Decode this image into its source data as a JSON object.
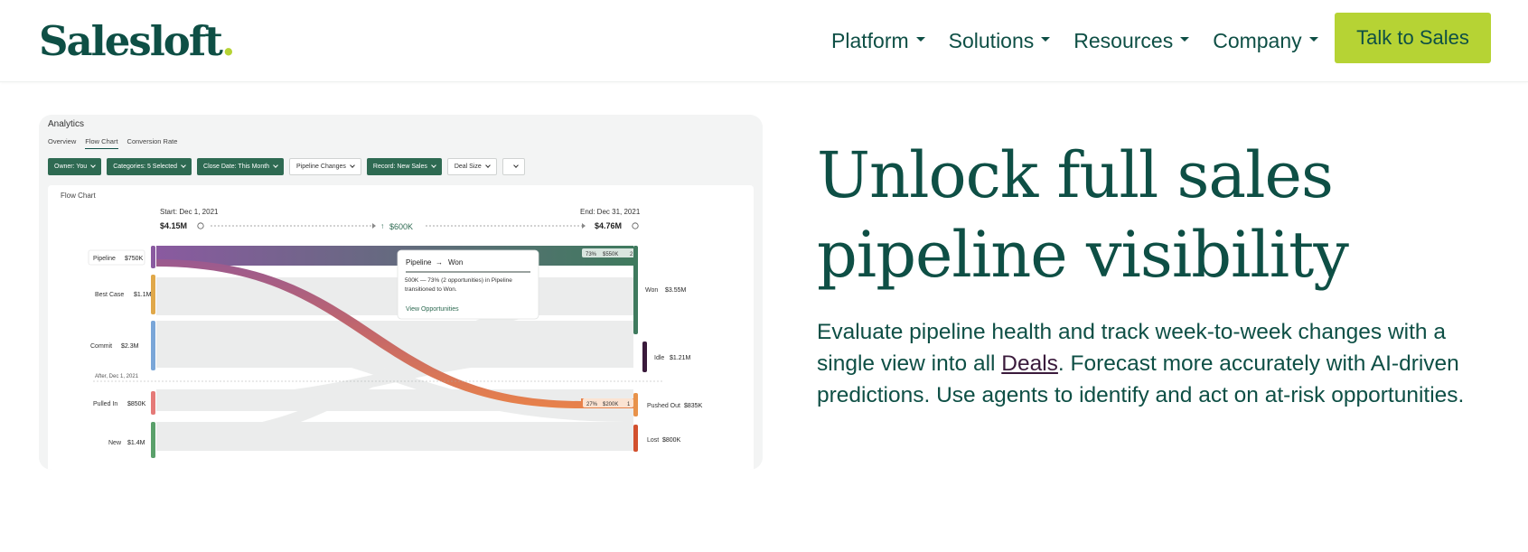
{
  "header": {
    "logo_text": "Salesloft",
    "logo_dot": ".",
    "nav": [
      {
        "label": "Platform"
      },
      {
        "label": "Solutions"
      },
      {
        "label": "Resources"
      },
      {
        "label": "Company"
      }
    ],
    "cta_label": "Talk to Sales"
  },
  "hero": {
    "title_line1": "Unlock full sales",
    "title_line2": "pipeline visibility",
    "body_before": "Evaluate pipeline health and track week-to-week changes with a single view into all ",
    "body_link": "Deals",
    "body_after": ". Forecast more accurately with AI-driven predictions. Use agents to identify and act on at-risk opportunities."
  },
  "analytics": {
    "title": "Analytics",
    "tabs": [
      "Overview",
      "Flow Chart",
      "Conversion Rate"
    ],
    "active_tab": "Flow Chart",
    "filters": [
      {
        "label": "Owner: You",
        "style": "dark"
      },
      {
        "label": "Categories: 5 Selected",
        "style": "dark"
      },
      {
        "label": "Close Date: This Month",
        "style": "dark"
      },
      {
        "label": "Pipeline Changes",
        "style": "light"
      },
      {
        "label": "Record: New Sales",
        "style": "dark"
      },
      {
        "label": "Deal Size",
        "style": "light"
      },
      {
        "label": "",
        "style": "light"
      }
    ],
    "panel_title": "Flow Chart",
    "start_label": "Start: Dec 1, 2021",
    "start_value": "$4.15M",
    "change_value": "$600K",
    "end_label": "End: Dec 31, 2021",
    "end_value": "$4.76M",
    "divider_label": "After, Dec 1, 2021",
    "left_nodes": [
      {
        "name": "Pipeline",
        "value": "$750K",
        "color": "#8a5aa0"
      },
      {
        "name": "Best Case",
        "value": "$1.1M",
        "color": "#e0a84a"
      },
      {
        "name": "Commit",
        "value": "$2.3M",
        "color": "#7aa6d8"
      },
      {
        "name": "Pulled In",
        "value": "$850K",
        "color": "#e57a78"
      },
      {
        "name": "New",
        "value": "$1.4M",
        "color": "#5aa06a"
      }
    ],
    "right_nodes": [
      {
        "name": "Won",
        "value": "$3.55M",
        "color": "#3f7a5e"
      },
      {
        "name": "Idle",
        "value": "$1.21M",
        "color": "#3a1a3b"
      },
      {
        "name": "Pushed Out",
        "value": "$835K",
        "color": "#e8924a"
      },
      {
        "name": "Lost",
        "value": "$800K",
        "color": "#d2502e"
      }
    ],
    "won_badge": {
      "pct": "73%",
      "amount": "$550K",
      "count": "2"
    },
    "pushed_badge": {
      "pct": "27%",
      "amount": "$200K",
      "count": "1"
    },
    "tooltip": {
      "from": "Pipeline",
      "arrow": "→",
      "to": "Won",
      "text": "500K — 73% (2 opportunities) in Pipeline transitioned to Won.",
      "link": "View Opportunities"
    }
  }
}
